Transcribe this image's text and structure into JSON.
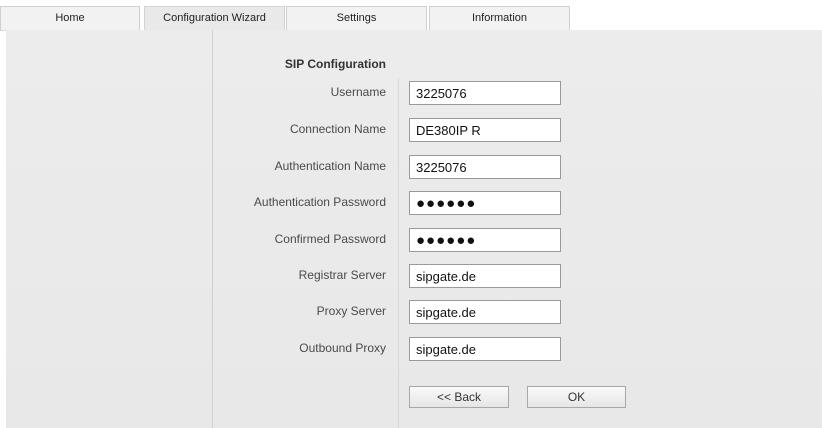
{
  "tabs": [
    {
      "label": "Home"
    },
    {
      "label": "Configuration Wizard"
    },
    {
      "label": "Settings"
    },
    {
      "label": "Information"
    }
  ],
  "active_tab": "Configuration Wizard",
  "form": {
    "title": "SIP Configuration",
    "fields": [
      {
        "label": "Username",
        "value": "3225076"
      },
      {
        "label": "Connection Name",
        "value": "DE380IP R"
      },
      {
        "label": "Authentication Name",
        "value": "3225076"
      },
      {
        "label": "Authentication Password",
        "value": "●●●●●●"
      },
      {
        "label": "Confirmed Password",
        "value": "●●●●●●"
      },
      {
        "label": "Registrar Server",
        "value": "sipgate.de"
      },
      {
        "label": "Proxy Server",
        "value": "sipgate.de"
      },
      {
        "label": "Outbound Proxy",
        "value": "sipgate.de"
      }
    ]
  },
  "buttons": {
    "back_label": "<< Back",
    "ok_label": "OK"
  }
}
